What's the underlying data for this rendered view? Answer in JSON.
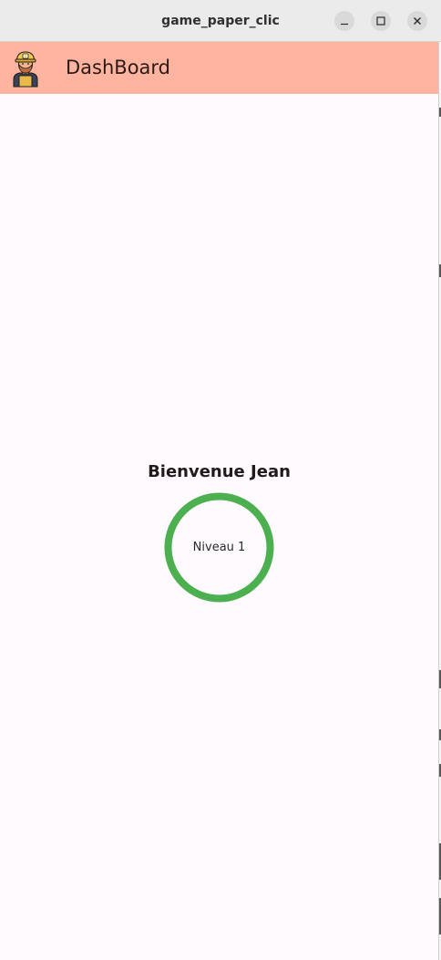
{
  "window": {
    "title": "game_paper_clic",
    "controls": {
      "minimize_icon": "minimize-icon",
      "maximize_icon": "maximize-icon",
      "close_icon": "close-icon"
    }
  },
  "appbar": {
    "title": "DashBoard",
    "avatar_icon": "miner-avatar-icon",
    "background": "#ffb4a0"
  },
  "main": {
    "welcome": "Bienvenue Jean",
    "level_label": "Niveau 1",
    "level_progress": 1.0,
    "ring_color": "#4caf50",
    "background": "#fffafd"
  }
}
